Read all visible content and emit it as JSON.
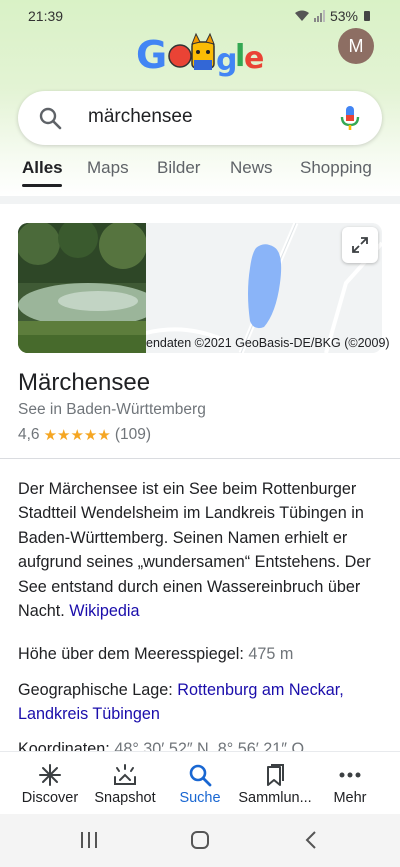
{
  "status_bar": {
    "time": "21:39",
    "battery": "53%"
  },
  "account": {
    "avatar_letter": "M"
  },
  "search": {
    "query": "märchensee"
  },
  "tabs": [
    {
      "label": "Alles"
    },
    {
      "label": "Maps"
    },
    {
      "label": "Bilder"
    },
    {
      "label": "News"
    },
    {
      "label": "Shopping"
    }
  ],
  "card": {
    "map_credit": "endaten ©2021 GeoBasis-DE/BKG (©2009)",
    "title": "Märchensee",
    "subtitle": "See in Baden-Württemberg",
    "rating": "4,6",
    "stars": "★★★★★",
    "review_count": "(109)",
    "description": "Der Märchensee ist ein See beim Rottenburger Stadtteil Wendelsheim im Landkreis Tübingen in Baden-Württemberg. Seinen Namen erhielt er aufgrund seines „wundersamen“ Entstehens. Der See entstand durch einen Wassereinbruch über Nacht.",
    "source_link": "Wikipedia",
    "facts": {
      "elevation_label": "Höhe über dem Meeresspiegel:",
      "elevation_value": "475 m",
      "location_label": "Geographische Lage:",
      "location_link_1": "Rottenburg am Neckar,",
      "location_link_2": "Landkreis Tübingen",
      "coords_label": "Koordinaten:",
      "coords_value": "48° 30′ 52″ N, 8° 56′ 21″ O"
    }
  },
  "bottom_nav": [
    {
      "label": "Discover",
      "icon": "asterisk-icon"
    },
    {
      "label": "Snapshot",
      "icon": "snapshot-icon"
    },
    {
      "label": "Suche",
      "icon": "search-icon"
    },
    {
      "label": "Sammlun...",
      "icon": "bookmark-icon"
    },
    {
      "label": "Mehr",
      "icon": "more-dots-icon"
    }
  ],
  "colors": {
    "accent": "#1967d2",
    "link": "#1a0dab",
    "star": "#f5a623",
    "header_green": "#d9f2c6"
  }
}
